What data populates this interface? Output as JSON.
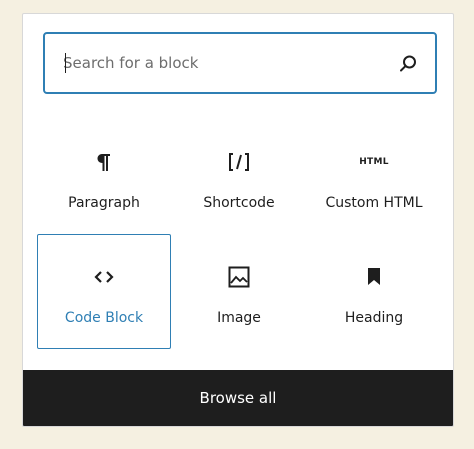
{
  "search": {
    "placeholder": "Search for a block",
    "value": ""
  },
  "blocks": [
    {
      "label": "Paragraph",
      "icon": "paragraph-icon",
      "selected": false
    },
    {
      "label": "Shortcode",
      "icon": "shortcode-icon",
      "selected": false
    },
    {
      "label": "Custom HTML",
      "icon": "html-icon",
      "icon_text": "HTML",
      "selected": false
    },
    {
      "label": "Code Block",
      "icon": "code-icon",
      "selected": true
    },
    {
      "label": "Image",
      "icon": "image-icon",
      "selected": false
    },
    {
      "label": "Heading",
      "icon": "bookmark-icon",
      "selected": false
    }
  ],
  "browse_all": {
    "label": "Browse all"
  },
  "colors": {
    "accent": "#2f7fb4",
    "text": "#1e1e1e",
    "background": "#f5f0e1",
    "footer": "#1e1e1e"
  }
}
